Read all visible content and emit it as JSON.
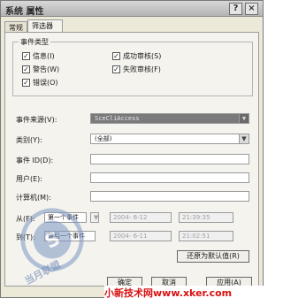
{
  "window": {
    "title": "系统 属性",
    "help_glyph": "?",
    "close_glyph": "×"
  },
  "tabs": [
    {
      "label": "常规"
    },
    {
      "label": "筛选器"
    }
  ],
  "event_types": {
    "title": "事件类型",
    "items": [
      {
        "label": "信息(I)",
        "checked": true
      },
      {
        "label": "成功审核(S)",
        "checked": true
      },
      {
        "label": "警告(W)",
        "checked": true
      },
      {
        "label": "失败审核(F)",
        "checked": true
      },
      {
        "label": "错误(O)",
        "checked": true
      }
    ]
  },
  "form": {
    "event_source_label": "事件来源(V):",
    "event_source_value": "SceCliAccess",
    "category_label": "类别(Y):",
    "category_value": "(全部)",
    "event_id_label": "事件 ID(D):",
    "event_id_value": "",
    "user_label": "用户(E):",
    "user_value": "",
    "computer_label": "计算机(M):",
    "computer_value": "",
    "from_label": "从(F):",
    "from_mode": "第一个事件",
    "from_date": "2004- 6-12",
    "from_time": "21:39:35",
    "to_label": "到(T):",
    "to_mode": "最后一个事件",
    "to_date": "2004- 6-11",
    "to_time": "21:02:51",
    "restore_defaults_label": "还原为默认值(R)"
  },
  "footer": {
    "ok_label": "确定",
    "cancel_label": "取消",
    "apply_label": "应用(A)"
  },
  "watermark": {
    "text": "当月联盟"
  },
  "banner": {
    "text": "小新技术网www.xker.com"
  },
  "icons": {
    "dropdown": "▼",
    "check": "✓"
  }
}
